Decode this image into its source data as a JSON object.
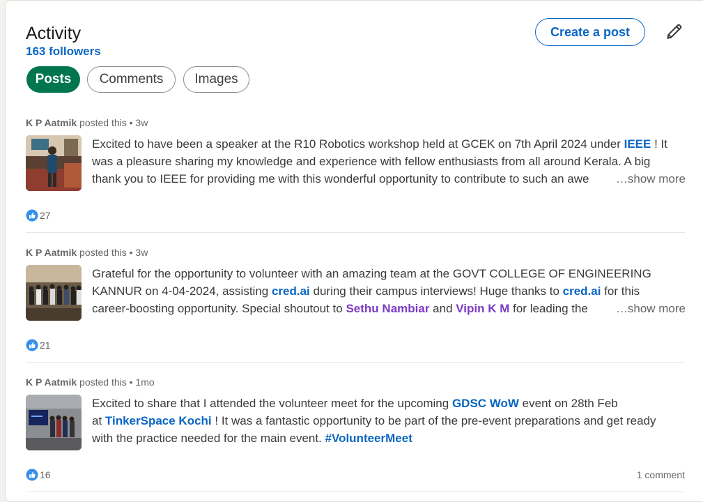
{
  "header": {
    "title": "Activity",
    "followers": "163 followers",
    "create_post_label": "Create a post"
  },
  "tabs": [
    {
      "label": "Posts",
      "active": true
    },
    {
      "label": "Comments",
      "active": false
    },
    {
      "label": "Images",
      "active": false
    }
  ],
  "posts": [
    {
      "author": "K P Aatmik",
      "posted": " posted this • 3w",
      "lines": [
        [
          "Excited to have been a speaker at the R10 Robotics workshop held at GCEK on 7th April 2024 under ",
          "IEEE",
          " ! It"
        ],
        [
          "was a pleasure sharing my knowledge and experience with fellow enthusiasts from all around Kerala. A big"
        ],
        [
          "thank you to IEEE for providing me with this wonderful opportunity to contribute to such an awe"
        ]
      ],
      "show_more": "…show more",
      "reactions": "27",
      "comments": ""
    },
    {
      "author": "K P Aatmik",
      "posted": " posted this • 3w",
      "lines": [
        [
          "Grateful for the opportunity to volunteer with an amazing team at the GOVT COLLEGE OF ENGINEERING"
        ],
        [
          "KANNUR on 4-04-2024, assisting ",
          "cred.ai",
          " during their campus interviews! Huge thanks to ",
          "cred.ai",
          " for this"
        ],
        [
          "career-boosting opportunity. Special shoutout to ",
          "Sethu Nambiar",
          " and ",
          "Vipin K M",
          " for leading the"
        ]
      ],
      "show_more": "…show more",
      "reactions": "21",
      "comments": ""
    },
    {
      "author": "K P Aatmik",
      "posted": " posted this • 1mo",
      "lines": [
        [
          "Excited to share that I attended the volunteer meet for the upcoming ",
          "GDSC WoW",
          " event on 28th Feb"
        ],
        [
          "at ",
          "TinkerSpace Kochi",
          " ! It was a fantastic opportunity to be part of the pre-event preparations and get ready"
        ],
        [
          "with the practice needed for the main event. ",
          "#VolunteerMeet"
        ]
      ],
      "show_more": "",
      "reactions": "16",
      "comments": "1 comment"
    }
  ]
}
